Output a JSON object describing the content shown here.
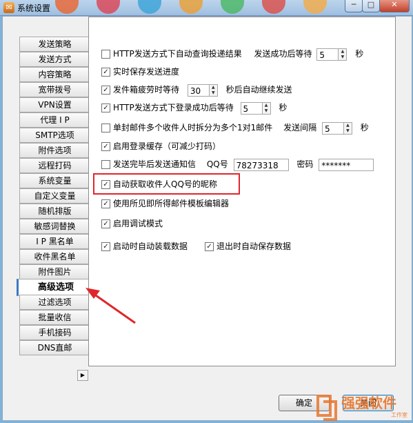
{
  "window": {
    "title": "系统设置"
  },
  "tabs": [
    "发送策略",
    "发送方式",
    "内容策略",
    "宽带拨号",
    "VPN设置",
    "代理 I P",
    "SMTP选项",
    "附件选项",
    "远程打码",
    "系统变量",
    "自定义变量",
    "随机排版",
    "敏感词替换",
    "I P 黑名单",
    "收件黑名单",
    "附件图片",
    "高级选项",
    "过滤选项",
    "批量收信",
    "手机接码",
    "DNS直邮"
  ],
  "active_tab": "高级选项",
  "options": {
    "http_query": {
      "label": "HTTP发送方式下自动查询投递结果",
      "checked": false,
      "wait_label": "发送成功后等待",
      "wait_value": "5",
      "unit": "秒"
    },
    "realtime_progress": {
      "label": "实时保存发送进度",
      "checked": true
    },
    "mailbox_fatigue": {
      "label": "发件箱疲劳时等待",
      "checked": true,
      "value": "30",
      "suffix": "秒后自动继续发送"
    },
    "http_login_wait": {
      "label": "HTTP发送方式下登录成功后等待",
      "checked": true,
      "value": "5",
      "unit": "秒"
    },
    "split_multi": {
      "label": "单封邮件多个收件人时拆分为多个1对1邮件",
      "checked": false,
      "interval_label": "发送间隔",
      "interval_value": "5",
      "unit": "秒"
    },
    "login_cache": {
      "label": "启用登录缓存（可减少打码）",
      "checked": true
    },
    "notify_after": {
      "label": "发送完毕后发送通知信",
      "checked": false,
      "qq_label": "QQ号",
      "qq_value": "78273318",
      "pwd_label": "密码",
      "pwd_value": "*******"
    },
    "auto_nickname": {
      "label": "自动获取收件人QQ号的昵称",
      "checked": true
    },
    "wysiwyg_editor": {
      "label": "使用所见即所得邮件模板编辑器",
      "checked": true
    },
    "debug_mode": {
      "label": "启用调试模式",
      "checked": true
    },
    "auto_load": {
      "label": "启动时自动装载数据",
      "checked": true
    },
    "auto_save": {
      "label": "退出时自动保存数据",
      "checked": true
    }
  },
  "buttons": {
    "ok": "确定",
    "close": "关闭"
  },
  "watermark": {
    "text": "强强软件",
    "sub": "工作室"
  },
  "colors": {
    "highlight": "#e0262a",
    "arrow": "#e0262a",
    "tab_accent": "#3a78c6"
  }
}
